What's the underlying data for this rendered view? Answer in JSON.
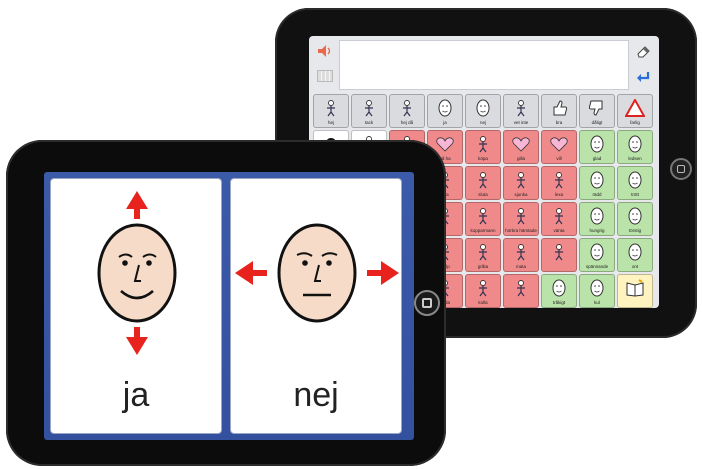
{
  "back_tablet": {
    "rows": [
      [
        {
          "label": "hej",
          "color": "grey",
          "icon": "waving-person-icon"
        },
        {
          "label": "tack",
          "color": "grey",
          "icon": "thanking-person-icon"
        },
        {
          "label": "hej då",
          "color": "grey",
          "icon": "waving-goodbye-icon"
        },
        {
          "label": "ja",
          "color": "grey",
          "icon": "yes-face-icon"
        },
        {
          "label": "nej",
          "color": "grey",
          "icon": "no-face-icon"
        },
        {
          "label": "vet inte",
          "color": "grey",
          "icon": "shrug-person-icon"
        },
        {
          "label": "bra",
          "color": "grey",
          "icon": "thumbs-up-icon"
        },
        {
          "label": "dåligt",
          "color": "grey",
          "icon": "thumbs-down-icon"
        },
        {
          "label": "farlig",
          "color": "grey",
          "icon": "warning-triangle-icon"
        }
      ],
      [
        {
          "label": "",
          "color": "white",
          "icon": "question-mark-icon"
        },
        {
          "label": "",
          "color": "white",
          "icon": "question-person-icon"
        },
        {
          "label": "",
          "color": "red",
          "icon": "person-action-icon"
        },
        {
          "label": "gå ha",
          "color": "red",
          "icon": "heart-person-icon"
        },
        {
          "label": "köpa",
          "color": "red",
          "icon": "shopping-icon"
        },
        {
          "label": "gilla",
          "color": "red",
          "icon": "heart-icon"
        },
        {
          "label": "vill",
          "color": "red",
          "icon": "heart-want-icon"
        },
        {
          "label": "glad",
          "color": "green",
          "icon": "happy-face-icon"
        },
        {
          "label": "ledsen",
          "color": "green",
          "icon": "sad-face-icon"
        }
      ],
      [
        {
          "label": "",
          "color": "white",
          "icon": "blank-icon"
        },
        {
          "label": "",
          "color": "white",
          "icon": "blank-icon"
        },
        {
          "label": "",
          "color": "red",
          "icon": "person-action-icon"
        },
        {
          "label": "titta",
          "color": "red",
          "icon": "look-icon"
        },
        {
          "label": "sluta",
          "color": "red",
          "icon": "stop-hand-icon"
        },
        {
          "label": "sjunka",
          "color": "red",
          "icon": "music-icon"
        },
        {
          "label": "lexa",
          "color": "red",
          "icon": "play-icon"
        },
        {
          "label": "rädd",
          "color": "green",
          "icon": "scared-face-icon"
        },
        {
          "label": "trött",
          "color": "green",
          "icon": "tired-face-icon"
        }
      ],
      [
        {
          "label": "",
          "color": "white",
          "icon": "blank-icon"
        },
        {
          "label": "",
          "color": "white",
          "icon": "blank-icon"
        },
        {
          "label": "",
          "color": "red",
          "icon": "person-action-icon"
        },
        {
          "label": "",
          "color": "red",
          "icon": "run-icon"
        },
        {
          "label": "kopparmann",
          "color": "red",
          "icon": "board-icon"
        },
        {
          "label": "hörbra hämtade",
          "color": "red",
          "icon": "fetch-icon"
        },
        {
          "label": "vänta",
          "color": "red",
          "icon": "wait-icon"
        },
        {
          "label": "hungrig",
          "color": "green",
          "icon": "hungry-face-icon"
        },
        {
          "label": "törstig",
          "color": "green",
          "icon": "thirsty-face-icon"
        }
      ],
      [
        {
          "label": "",
          "color": "white",
          "icon": "blank-icon"
        },
        {
          "label": "",
          "color": "white",
          "icon": "blank-icon"
        },
        {
          "label": "",
          "color": "red",
          "icon": "person-action-icon"
        },
        {
          "label": "hjälp",
          "color": "red",
          "icon": "help-icon"
        },
        {
          "label": "gråta",
          "color": "red",
          "icon": "cry-icon"
        },
        {
          "label": "mata",
          "color": "red",
          "icon": "feed-icon"
        },
        {
          "label": "",
          "color": "red",
          "icon": "person-action-icon"
        },
        {
          "label": "spännande",
          "color": "green",
          "icon": "excited-face-icon"
        },
        {
          "label": "ont",
          "color": "green",
          "icon": "hurt-face-icon"
        }
      ],
      [
        {
          "label": "",
          "color": "white",
          "icon": "blank-icon"
        },
        {
          "label": "",
          "color": "white",
          "icon": "blank-icon"
        },
        {
          "label": "",
          "color": "red",
          "icon": "person-action-icon"
        },
        {
          "label": "bada",
          "color": "red",
          "icon": "bath-icon"
        },
        {
          "label": "kolla",
          "color": "red",
          "icon": "tv-icon"
        },
        {
          "label": "",
          "color": "red",
          "icon": "person-action-icon"
        },
        {
          "label": "tråkigt",
          "color": "green",
          "icon": "bored-face-icon"
        },
        {
          "label": "kul",
          "color": "green",
          "icon": "fun-face-icon"
        },
        {
          "label": "",
          "color": "yellow",
          "icon": "book-icon"
        }
      ]
    ]
  },
  "front_tablet": {
    "cards": [
      {
        "word": "ja",
        "icon": "yes-face-icon"
      },
      {
        "word": "nej",
        "icon": "no-face-icon"
      }
    ]
  },
  "colors": {
    "red_arrow": "#e8231e",
    "face_fill": "#f6dcc8",
    "cell_red": "#f08a8a",
    "cell_green": "#b9e3a8"
  }
}
